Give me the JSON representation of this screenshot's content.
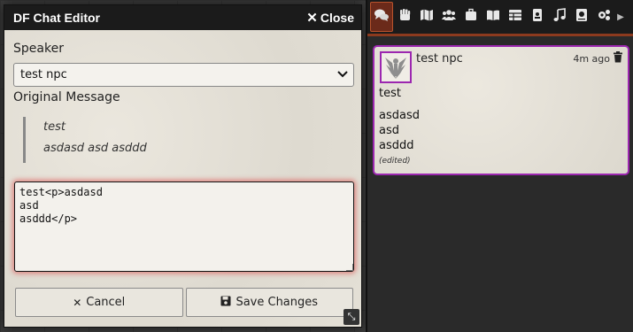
{
  "dialog": {
    "title": "DF Chat Editor",
    "close_label": "Close",
    "speaker_label": "Speaker",
    "speaker_value": "test npc",
    "original_label": "Original Message",
    "original_lines": [
      "test",
      "asdasd asd asddd"
    ],
    "editor_value": "test<p>asdasd\nasd\nasddd</p>",
    "cancel_label": "Cancel",
    "save_label": "Save Changes"
  },
  "sidebar": {
    "tabs": [
      {
        "name": "chat-tab",
        "icon": "chat-icon",
        "active": true
      },
      {
        "name": "combat-tab",
        "icon": "fist-icon"
      },
      {
        "name": "scenes-tab",
        "icon": "map-icon"
      },
      {
        "name": "actors-tab",
        "icon": "users-icon"
      },
      {
        "name": "items-tab",
        "icon": "suitcase-icon"
      },
      {
        "name": "journal-tab",
        "icon": "book-open-icon"
      },
      {
        "name": "tables-tab",
        "icon": "table-icon"
      },
      {
        "name": "cards-tab",
        "icon": "id-badge-icon"
      },
      {
        "name": "playlists-tab",
        "icon": "music-icon"
      },
      {
        "name": "compendium-tab",
        "icon": "atlas-icon"
      },
      {
        "name": "settings-tab",
        "icon": "cogs-icon"
      }
    ],
    "chat": {
      "speaker": "test npc",
      "timestamp": "4m ago",
      "line1": "test",
      "block": [
        "asdasd",
        "asd",
        "asddd"
      ],
      "edited": "(edited)"
    }
  },
  "colors": {
    "accent_purple": "#9c27b0",
    "tab_active": "#6b2a1a",
    "header_bg": "#1b1b1b"
  }
}
